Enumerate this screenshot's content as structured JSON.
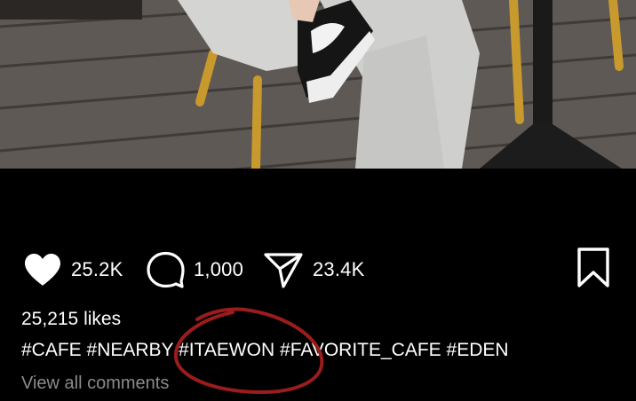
{
  "post": {
    "image_alt": "person in grey sweatpants and sneakers sitting on cafe chair",
    "actions": {
      "like_count": "25.2K",
      "comment_count": "1,000",
      "share_count": "23.4K"
    },
    "likes_text": "25,215 likes",
    "hashtags": [
      "#CAFE",
      "#NEARBY",
      "#ITAEWON",
      "#FAVORITE_CAFE",
      "#EDEN"
    ],
    "view_comments": "View all comments"
  },
  "colors": {
    "background": "#000000",
    "text": "#ffffff",
    "muted_text": "#8a8a8a",
    "annotation": "#9b1c1c"
  },
  "icons": [
    "heart-icon",
    "comment-icon",
    "share-icon",
    "bookmark-icon"
  ]
}
